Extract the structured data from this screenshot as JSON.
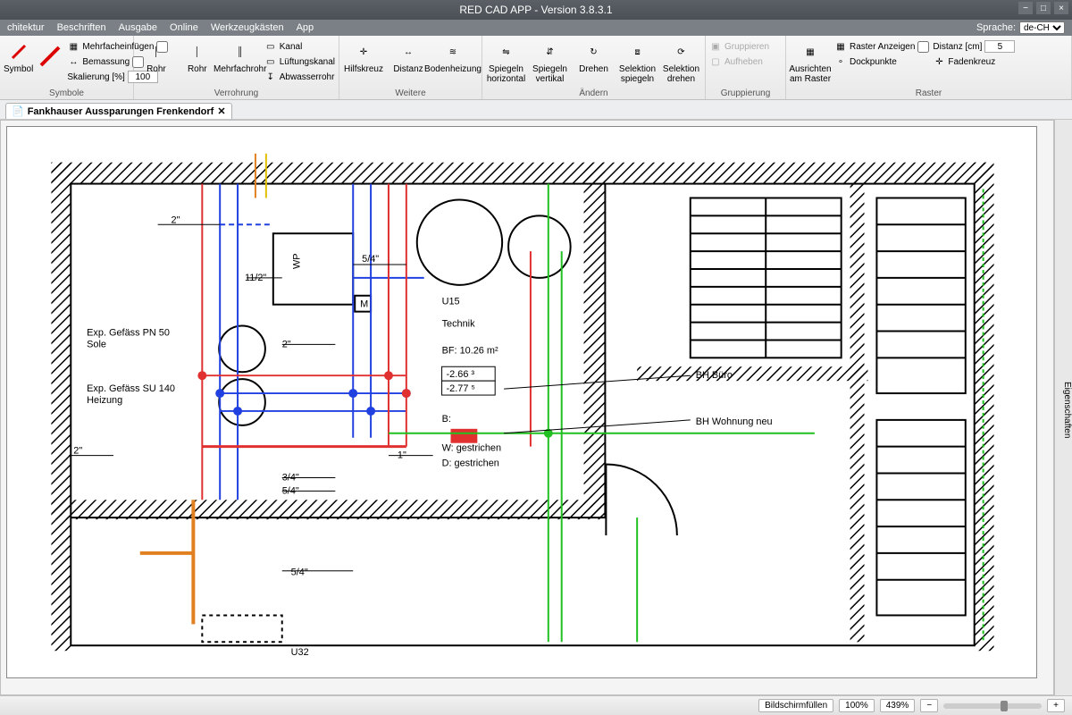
{
  "title": "RED CAD APP - Version 3.8.3.1",
  "menu": [
    "chitektur",
    "Beschriften",
    "Ausgabe",
    "Online",
    "Werkzeugkästen",
    "App"
  ],
  "language_label": "Sprache:",
  "language_value": "de-CH",
  "ribbon": {
    "symbole": {
      "label": "Symbole",
      "symbol": "Symbol",
      "mehrfach": "Mehrfacheinfügen",
      "bemassung": "Bemassung",
      "skalierung": "Skalierung [%]",
      "skalierung_value": "100"
    },
    "verrohrung": {
      "label": "Verrohrung",
      "rohr1": "Rohr",
      "rohr2": "Rohr",
      "mehrfachrohr": "Mehrfachrohr",
      "kanal": "Kanal",
      "lueftung": "Lüftungskanal",
      "abwasser": "Abwasserrohr"
    },
    "weitere": {
      "label": "Weitere",
      "hilfskreuz": "Hilfskreuz",
      "distanz": "Distanz",
      "bodenheizung": "Bodenheizung"
    },
    "aendern": {
      "label": "Ändern",
      "spiegel_h": "Spiegeln horizontal",
      "spiegel_v": "Spiegeln vertikal",
      "drehen": "Drehen",
      "selektion_spiegeln": "Selektion spiegeln",
      "selektion_drehen": "Selektion drehen"
    },
    "gruppierung": {
      "label": "Gruppierung",
      "gruppieren": "Gruppieren",
      "aufheben": "Aufheben"
    },
    "raster": {
      "label": "Raster",
      "ausrichten": "Ausrichten am Raster",
      "anzeigen": "Raster Anzeigen",
      "dockpunkte": "Dockpunkte",
      "fadenkreuz": "Fadenkreuz",
      "distanz_label": "Distanz [cm]",
      "distanz_value": "5"
    }
  },
  "document_tab": "Fankhauser Aussparungen Frenkendorf",
  "side_panel": "Eigenschaften",
  "status": {
    "bildschirm": "Bildschirmfüllen",
    "zoom1": "100%",
    "zoom2": "439%",
    "minus": "−",
    "plus": "+"
  },
  "drawing": {
    "exp1": "Exp. Gefäss PN 50",
    "exp1b": "Sole",
    "exp2": "Exp. Gefäss SU 140",
    "exp2b": "Heizung",
    "room": "U15",
    "room_label": "Technik",
    "bf": "BF:  10.26   m²",
    "val1": "-2.66 ³",
    "val2": "-2.77 ⁵",
    "line_b": "B:",
    "line_w": "W: gestrichen",
    "line_d": "D: gestrichen",
    "bh1": "BH Büro",
    "bh2": "BH Wohnung neu",
    "u32": "U32",
    "d2a": "2\"",
    "d2b": "2\"",
    "d2c": "2\"",
    "d54a": "5/4\"",
    "d54b": "5/4\"",
    "d54c": "5/4\"",
    "d112": "11/2\"",
    "d34": "3/4\"",
    "d1": "1\"",
    "wp": "WP",
    "m": "M"
  }
}
